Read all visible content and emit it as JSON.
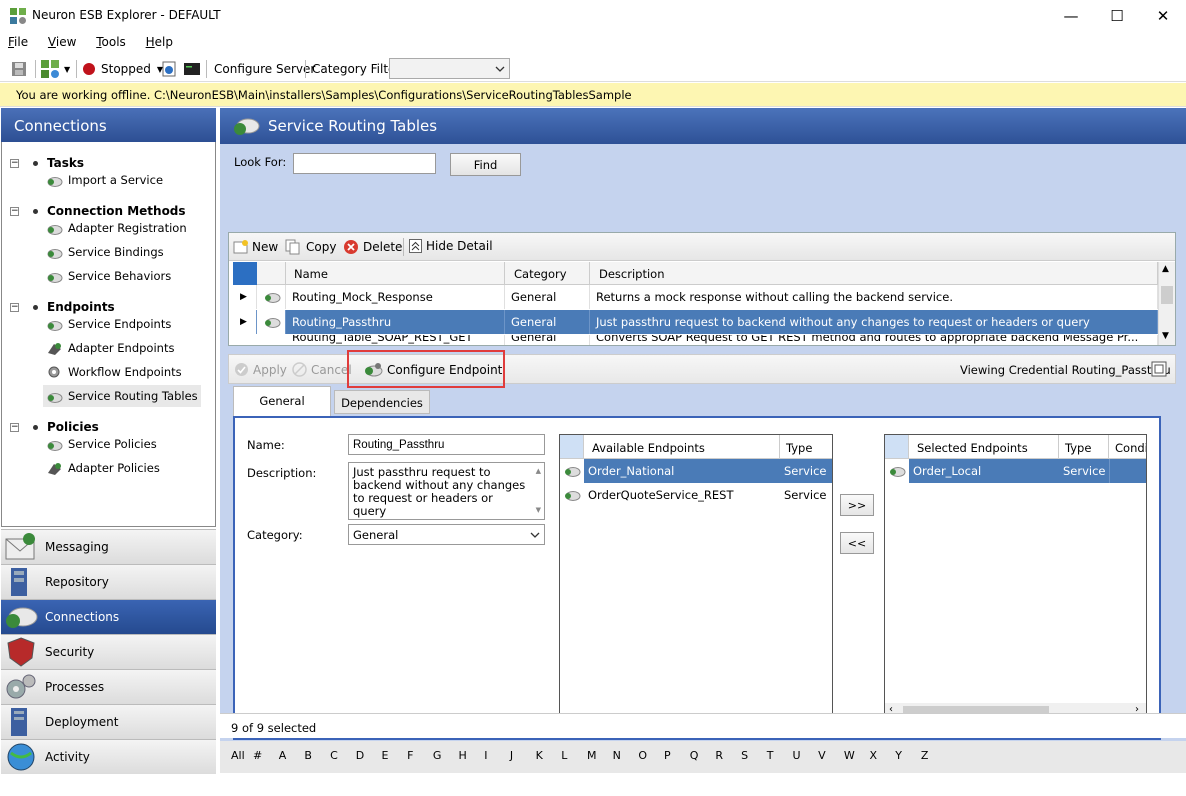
{
  "window": {
    "title": "Neuron ESB Explorer - DEFAULT",
    "minimize": "—",
    "maximize": "☐",
    "close": "✕"
  },
  "menu": [
    {
      "label": "File",
      "key": "F",
      "rest": "ile"
    },
    {
      "label": "View",
      "key": "V",
      "rest": "iew"
    },
    {
      "label": "Tools",
      "key": "T",
      "rest": "ools"
    },
    {
      "label": "Help",
      "key": "H",
      "rest": "elp"
    }
  ],
  "toolbar": {
    "status": "Stopped",
    "configure_server": "Configure Server",
    "category_filter": "Category Filter",
    "category_value": ""
  },
  "offline_banner": "You are working offline. C:\\NeuronESB\\Main\\installers\\Samples\\Configurations\\ServiceRoutingTablesSample",
  "left": {
    "header": "Connections",
    "tree": {
      "tasks": {
        "label": "Tasks",
        "items": [
          "Import a Service"
        ]
      },
      "methods": {
        "label": "Connection Methods",
        "items": [
          "Adapter Registration",
          "Service Bindings",
          "Service Behaviors"
        ]
      },
      "endpoints": {
        "label": "Endpoints",
        "items": [
          "Service Endpoints",
          "Adapter Endpoints",
          "Workflow Endpoints",
          "Service Routing Tables"
        ]
      },
      "policies": {
        "label": "Policies",
        "items": [
          "Service Policies",
          "Adapter Policies"
        ]
      }
    },
    "nav": [
      "Messaging",
      "Repository",
      "Connections",
      "Security",
      "Processes",
      "Deployment",
      "Activity"
    ]
  },
  "main": {
    "title": "Service Routing Tables",
    "look_for_label": "Look For:",
    "look_for_value": "",
    "find_button": "Find",
    "grid_tools": {
      "new": "New",
      "copy": "Copy",
      "delete": "Delete",
      "hide_detail": "Hide Detail"
    },
    "columns": [
      "Name",
      "Category",
      "Description"
    ],
    "rows": [
      {
        "name": "Routing_Mock_Response",
        "category": "General",
        "description": "Returns a mock response without calling the backend service."
      },
      {
        "name": "Routing_Passthru",
        "category": "General",
        "description": "Just passthru request to backend without any changes to request or headers or query"
      },
      {
        "name": "Routing_Table_SOAP_REST_GET",
        "category": "General",
        "description": "Converts SOAP Request to GET REST method and routes to appropriate backend Message Pr..."
      }
    ],
    "detail_tools": {
      "apply": "Apply",
      "cancel": "Cancel",
      "configure_endpoint": "Configure Endpoint",
      "viewing": "Viewing Credential Routing_Passthru"
    },
    "tabs": [
      "General",
      "Dependencies"
    ],
    "form": {
      "name_label": "Name:",
      "name_value": "Routing_Passthru",
      "description_label": "Description:",
      "description_value": "Just passthru request to backend without any changes to request or headers or query",
      "category_label": "Category:",
      "category_value": "General"
    },
    "available": {
      "headers": [
        "Available Endpoints",
        "Type"
      ],
      "rows": [
        {
          "name": "Order_National",
          "type": "Service"
        },
        {
          "name": "OrderQuoteService_REST",
          "type": "Service"
        }
      ]
    },
    "move_right": ">>",
    "move_left": "<<",
    "selected": {
      "headers": [
        "Selected Endpoints",
        "Type",
        "Conditi"
      ],
      "rows": [
        {
          "name": "Order_Local",
          "type": "Service"
        }
      ]
    },
    "status": "9 of 9 selected",
    "alphabet": [
      "All",
      "#",
      "A",
      "B",
      "C",
      "D",
      "E",
      "F",
      "G",
      "H",
      "I",
      "J",
      "K",
      "L",
      "M",
      "N",
      "O",
      "P",
      "Q",
      "R",
      "S",
      "T",
      "U",
      "V",
      "W",
      "X",
      "Y",
      "Z"
    ]
  }
}
